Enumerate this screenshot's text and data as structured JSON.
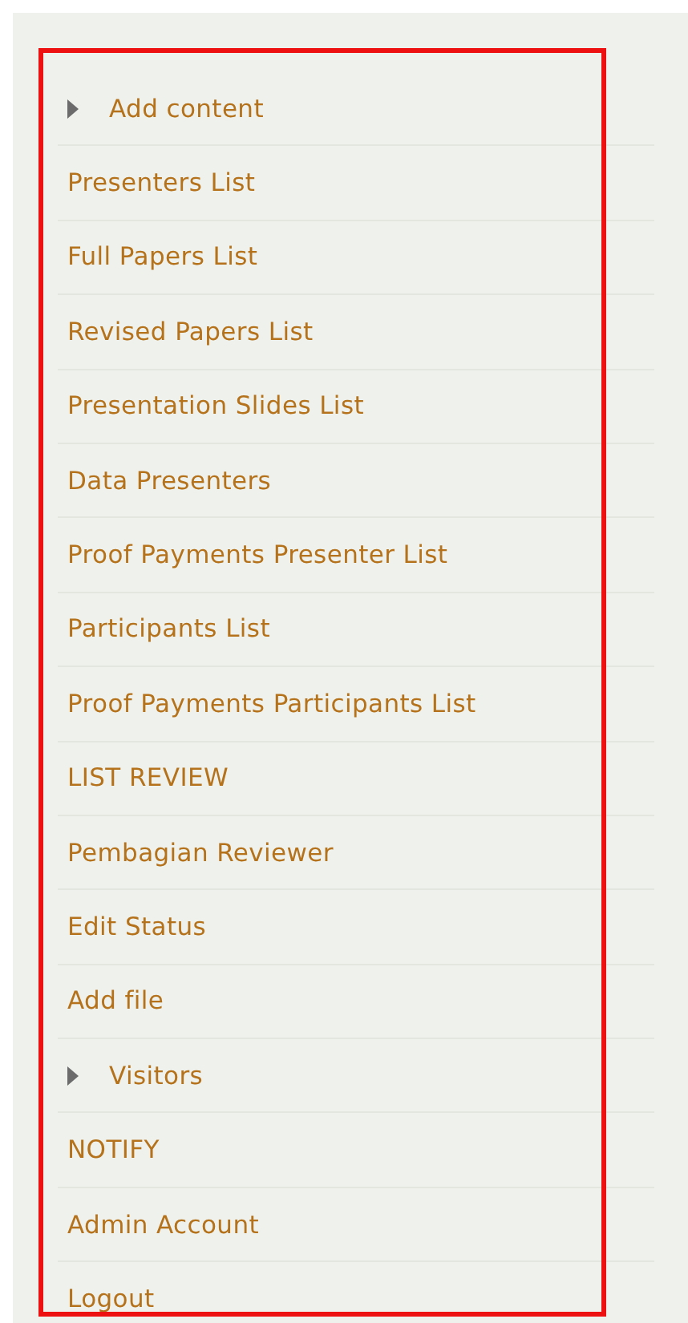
{
  "menu": {
    "items": [
      {
        "label": "Add content",
        "kind": "collapsible",
        "expanded": false
      },
      {
        "label": "Presenters List",
        "kind": "link"
      },
      {
        "label": "Full Papers List",
        "kind": "link"
      },
      {
        "label": "Revised Papers List",
        "kind": "link"
      },
      {
        "label": "Presentation Slides List",
        "kind": "link"
      },
      {
        "label": "Data Presenters",
        "kind": "link"
      },
      {
        "label": "Proof Payments Presenter List",
        "kind": "link"
      },
      {
        "label": "Participants List",
        "kind": "link"
      },
      {
        "label": "Proof Payments Participants List",
        "kind": "link"
      },
      {
        "label": "LIST REVIEW",
        "kind": "link"
      },
      {
        "label": "Pembagian Reviewer",
        "kind": "link"
      },
      {
        "label": "Edit Status",
        "kind": "link"
      },
      {
        "label": "Add file",
        "kind": "link"
      },
      {
        "label": "Visitors",
        "kind": "collapsible",
        "expanded": false
      },
      {
        "label": "NOTIFY",
        "kind": "link"
      },
      {
        "label": "Admin Account",
        "kind": "link"
      },
      {
        "label": "Logout",
        "kind": "link"
      }
    ]
  }
}
